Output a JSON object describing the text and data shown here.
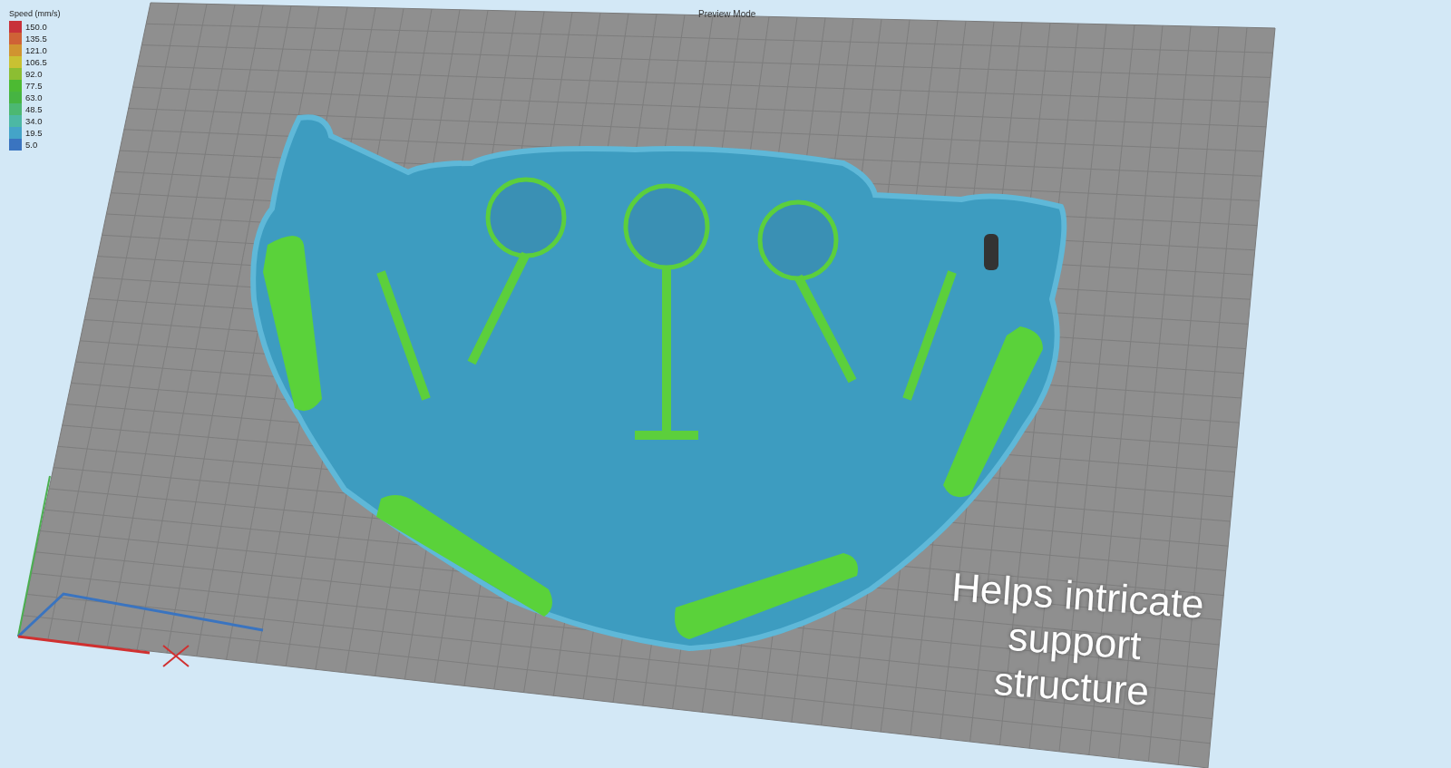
{
  "window": {
    "title": "Preview Mode"
  },
  "legend": {
    "title": "Speed (mm/s)",
    "items": [
      {
        "label": "150.0",
        "color": "#c8323a"
      },
      {
        "label": "135.5",
        "color": "#cf6236"
      },
      {
        "label": "121.0",
        "color": "#d09430"
      },
      {
        "label": "106.5",
        "color": "#c9c132"
      },
      {
        "label": "92.0",
        "color": "#8cbe32"
      },
      {
        "label": "77.5",
        "color": "#4cba32"
      },
      {
        "label": "63.0",
        "color": "#46b442"
      },
      {
        "label": "48.5",
        "color": "#4cb872"
      },
      {
        "label": "34.0",
        "color": "#4cb8a4"
      },
      {
        "label": "19.5",
        "color": "#44a4c8"
      },
      {
        "label": "5.0",
        "color": "#3a74c0"
      }
    ]
  },
  "caption": "Helps intricate support structure"
}
